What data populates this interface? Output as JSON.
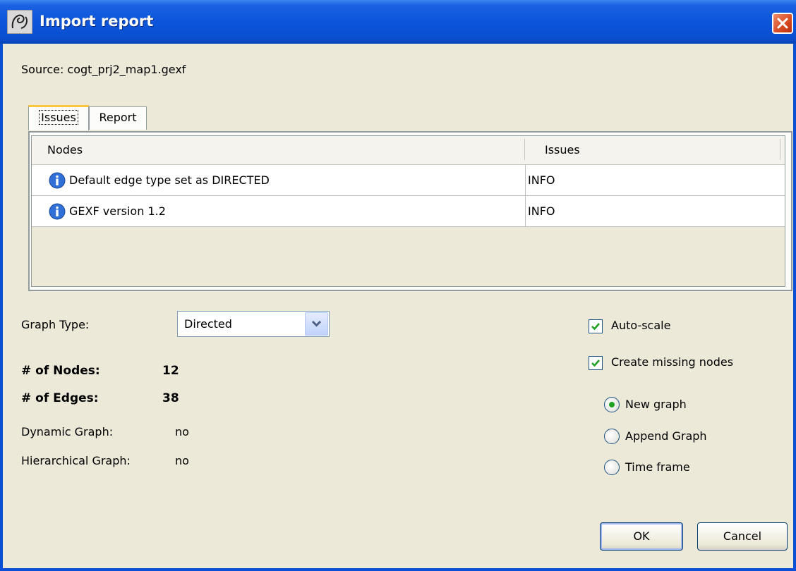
{
  "window": {
    "title": "Import report"
  },
  "source": {
    "text": "Source:  cogt_prj2_map1.gexf"
  },
  "tabs": [
    {
      "label": "Issues",
      "active": true
    },
    {
      "label": "Report",
      "active": false
    }
  ],
  "table": {
    "columns": [
      "Nodes",
      "Issues"
    ],
    "rows": [
      {
        "icon": "info-icon",
        "message": "Default edge type set as DIRECTED",
        "level": "INFO"
      },
      {
        "icon": "info-icon",
        "message": "GEXF version 1.2",
        "level": "INFO"
      }
    ]
  },
  "graph_type": {
    "label": "Graph Type:",
    "value": "Directed"
  },
  "stats": {
    "nodes_label": "# of Nodes:",
    "nodes_value": "12",
    "edges_label": "# of Edges:",
    "edges_value": "38",
    "dynamic_label": "Dynamic Graph:",
    "dynamic_value": "no",
    "hierarchical_label": "Hierarchical Graph:",
    "hierarchical_value": "no"
  },
  "options": {
    "auto_scale": {
      "label": "Auto-scale",
      "checked": true
    },
    "create_missing": {
      "label": "Create missing nodes",
      "checked": true
    },
    "radios": [
      {
        "label": "New graph",
        "selected": true
      },
      {
        "label": "Append Graph",
        "selected": false
      },
      {
        "label": "Time frame",
        "selected": false
      }
    ]
  },
  "buttons": {
    "ok": "OK",
    "cancel": "Cancel"
  },
  "colors": {
    "titlebar": "#0a4fd6",
    "dialog_bg": "#ece9d8",
    "check": "#21a121"
  }
}
